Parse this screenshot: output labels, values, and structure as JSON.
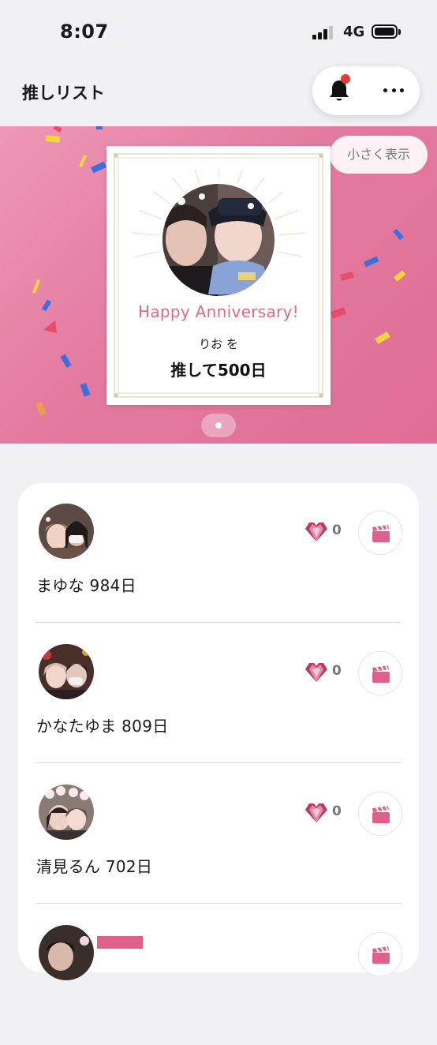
{
  "status_bar": {
    "time": "8:07",
    "network": "4G"
  },
  "header": {
    "title": "推しリスト",
    "bell_icon": "bell-icon",
    "more_icon": "more-icon",
    "notification_dot_color": "#e53935"
  },
  "banner": {
    "toggle_label": "小さく表示",
    "card": {
      "title": "Happy Anniversary!",
      "name_line": "りお を",
      "days_line": "推して500日"
    },
    "page_count": 1,
    "gradient_colors": [
      "#ee97b6",
      "#df6e96"
    ]
  },
  "oshi_list": [
    {
      "name_days": "まゆな  984日",
      "heart_count": "0"
    },
    {
      "name_days": "かなたゆま  809日",
      "heart_count": "0"
    },
    {
      "name_days": "清見るん  702日",
      "heart_count": "0"
    },
    {
      "name_days": "",
      "heart_count": ""
    }
  ],
  "colors": {
    "accent_pink": "#e0608a",
    "heart_dark": "#b83a66",
    "background": "#f1f0f5"
  }
}
